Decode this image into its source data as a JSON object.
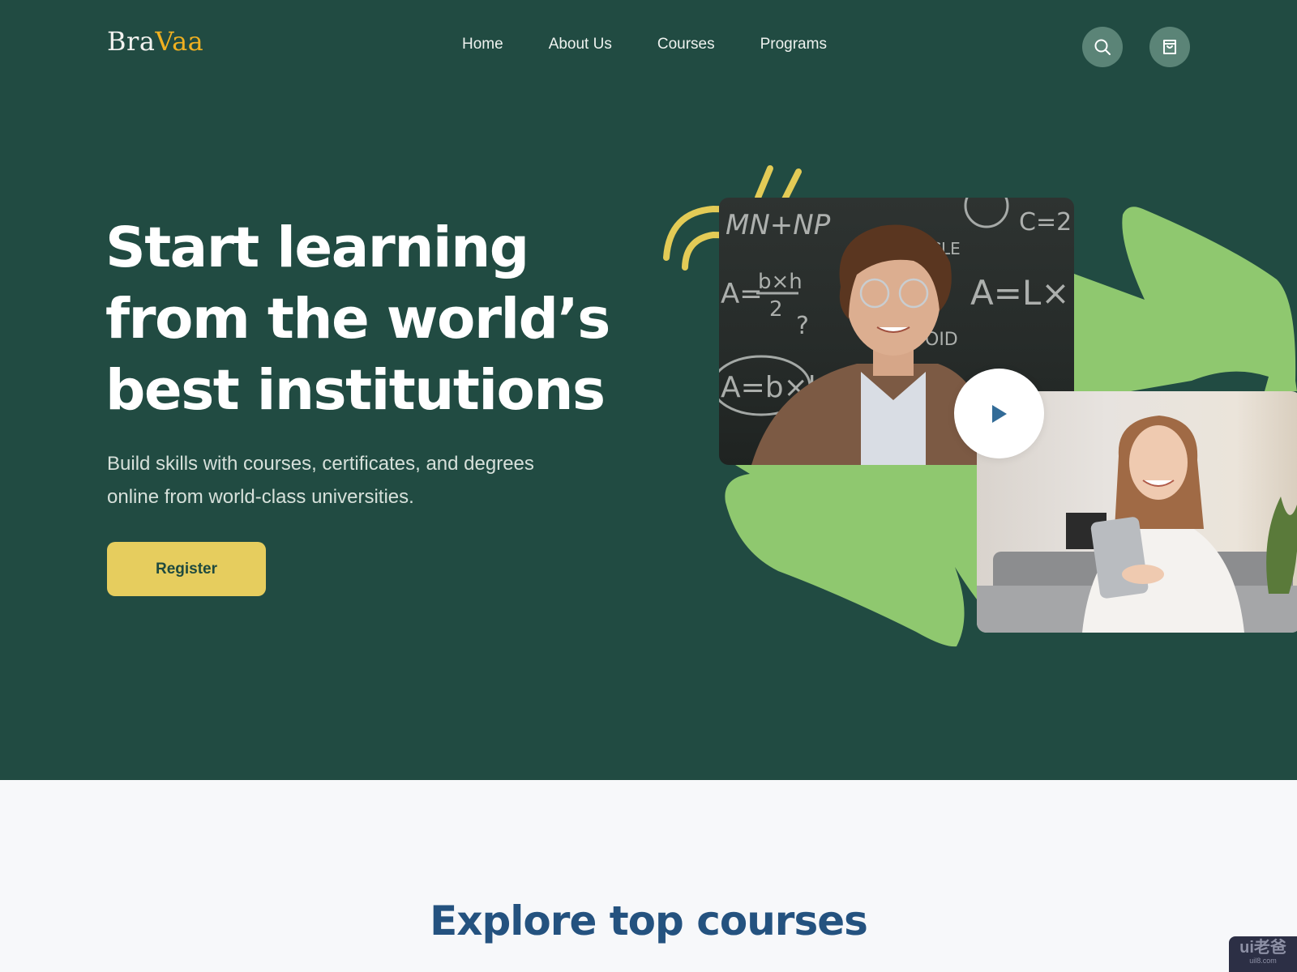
{
  "brand": {
    "name_part1": "Bra",
    "name_part2": "Vaa"
  },
  "nav": {
    "items": [
      {
        "label": "Home"
      },
      {
        "label": "About Us"
      },
      {
        "label": "Courses"
      },
      {
        "label": "Programs"
      }
    ]
  },
  "header_actions": {
    "search_icon": "search-icon",
    "cart_icon": "shopping-bag-icon"
  },
  "hero": {
    "headline_line1": "Start learning",
    "headline_line2": "from the world’s",
    "headline_line3": "best institutions",
    "subtext": "Build skills with courses, certificates, and degrees online from world-class universities.",
    "cta_label": "Register",
    "media": {
      "image1": "teacher-at-chalkboard-photo",
      "image2": "student-holding-tablet-photo",
      "play_icon": "play-icon",
      "chalk_formulas": [
        "MN+NP",
        "A = b×h / 2",
        "A = L×",
        "A = b×h",
        "C = 2",
        "?"
      ]
    }
  },
  "explore": {
    "title": "Explore top courses"
  },
  "watermark": {
    "main": "ui老爸",
    "sub": "uil8.com"
  },
  "colors": {
    "hero_bg": "#214b42",
    "accent_yellow": "#e6cd5e",
    "logo_accent": "#f0b020",
    "leaf_green": "#8fc86f",
    "heading_blue": "#24527f",
    "page_bg": "#f7f8fa"
  }
}
